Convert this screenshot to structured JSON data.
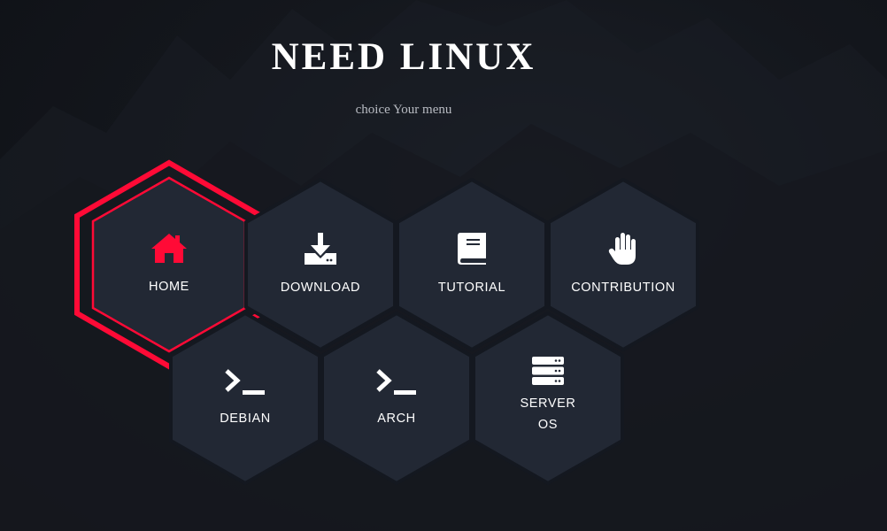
{
  "header": {
    "title": "NEED LINUX",
    "subtitle": "choice Your menu"
  },
  "colors": {
    "accent": "#ff0a36",
    "hex_fill": "#222834",
    "hex_border": "#141820",
    "background": "#14171d"
  },
  "menu": [
    {
      "label": "HOME",
      "icon": "home-icon",
      "active": true
    },
    {
      "label": "DOWNLOAD",
      "icon": "download-icon",
      "active": false
    },
    {
      "label": "TUTORIAL",
      "icon": "book-icon",
      "active": false
    },
    {
      "label": "CONTRIBUTION",
      "icon": "hand-icon",
      "active": false
    },
    {
      "label": "DEBIAN",
      "icon": "terminal-icon",
      "active": false
    },
    {
      "label": "ARCH",
      "icon": "terminal-icon",
      "active": false
    },
    {
      "label": "SERVER\nOS",
      "icon": "server-icon",
      "active": false
    }
  ]
}
